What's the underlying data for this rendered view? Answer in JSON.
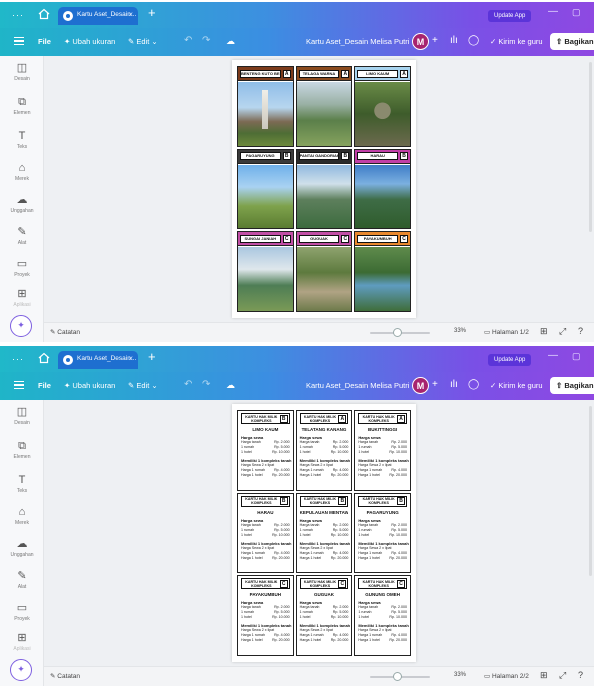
{
  "browser": {
    "tab_title": "Kartu Aset_Desain...",
    "tab_close": "×",
    "new_tab": "+",
    "update_btn": "Update App",
    "menu_dots": "···"
  },
  "toolbar": {
    "file_label": "File",
    "resize_label": "Ubah ukuran",
    "edit_label": "Edit",
    "doc_title": "Kartu Aset_Desain Melisa Putri",
    "avatar_letter": "M",
    "send_label": "Kirim ke guru",
    "share_label": "Bagikan"
  },
  "sidebar": {
    "items": [
      {
        "icon": "design-icon",
        "label": "Desain"
      },
      {
        "icon": "elements-icon",
        "label": "Elemen"
      },
      {
        "icon": "text-icon",
        "label": "Teks"
      },
      {
        "icon": "brand-icon",
        "label": "Merek"
      },
      {
        "icon": "uploads-icon",
        "label": "Unggahan"
      },
      {
        "icon": "draw-icon",
        "label": "Alat"
      },
      {
        "icon": "projects-icon",
        "label": "Proyek"
      },
      {
        "icon": "apps-icon",
        "label": "Aplikasi"
      }
    ]
  },
  "screen1": {
    "cards": [
      {
        "name": "BENTENG KUTO BESAK",
        "letter": "A"
      },
      {
        "name": "TELAGA WARNA",
        "letter": "A"
      },
      {
        "name": "LIMO KAUM",
        "letter": "A"
      },
      {
        "name": "PAGARUYUNG",
        "letter": "B"
      },
      {
        "name": "PANTAI GANDORIAH",
        "letter": "B"
      },
      {
        "name": "HARAU",
        "letter": "B"
      },
      {
        "name": "SUNGAI JANIAH",
        "letter": "C"
      },
      {
        "name": "GUGUAK",
        "letter": "C"
      },
      {
        "name": "PAYAKUMBUH",
        "letter": "C"
      }
    ],
    "header_colors": [
      "#7c3b1b",
      "#8b4b1e",
      "#a8d4ef",
      "#3a3a3a",
      "#2b2b2b",
      "#c03fa6",
      "#c24fa6",
      "#c24fa6",
      "#e9892f"
    ],
    "zoom": "33%",
    "pages": "Halaman",
    "page_count": "1/2"
  },
  "screen2": {
    "cards": [
      {
        "head": "KARTU HAK MILIK KOMPLEKS",
        "letter": "B",
        "place": "LIMO KAUM"
      },
      {
        "head": "KARTU HAK MILIK KOMPLEKS",
        "letter": "A",
        "place": "TELATANG KANANG"
      },
      {
        "head": "KARTU HAK MILIK KOMPLEKS",
        "letter": "A",
        "place": "BUKITTINGGI"
      },
      {
        "head": "KARTU HAK MILIK KOMPLEKS",
        "letter": "B",
        "place": "HARAU"
      },
      {
        "head": "KARTU HAK MILIK KOMPLEKS",
        "letter": "B",
        "place": "KEPULAUAN MENTAWAI"
      },
      {
        "head": "KARTU HAK MILIK KOMPLEKS",
        "letter": "B",
        "place": "PAGARUYUNG"
      },
      {
        "head": "KARTU HAK MILIK KOMPLEKS",
        "letter": "C",
        "place": "PAYAKUMBUH"
      },
      {
        "head": "KARTU HAK MILIK KOMPLEKS",
        "letter": "C",
        "place": "GUGUAK"
      },
      {
        "head": "KARTU HAK MILIK KOMPLEKS",
        "letter": "C",
        "place": "GUNUNG OMEH"
      }
    ],
    "rent_title": "Harga sewa",
    "rent_rows": [
      {
        "k": "Harga tanah",
        "v": "Rp. 2.000"
      },
      {
        "k": "1 rumah",
        "v": "Rp. 5.000"
      },
      {
        "k": "1 hotel",
        "v": "Rp. 10.000"
      }
    ],
    "set_title": "Memiliki 1 kompleks tanah",
    "set_rows": [
      {
        "k": "Harga Sewa 2 x lipat",
        "v": ""
      },
      {
        "k": "Harga 1 rumah",
        "v": "Rp. 4.000"
      },
      {
        "k": "Harga 1 hotel",
        "v": "Rp. 20.000"
      }
    ],
    "zoom": "33%",
    "pages": "Halaman",
    "page_count": "2/2"
  },
  "footer": {
    "notes_label": "Catatan"
  }
}
